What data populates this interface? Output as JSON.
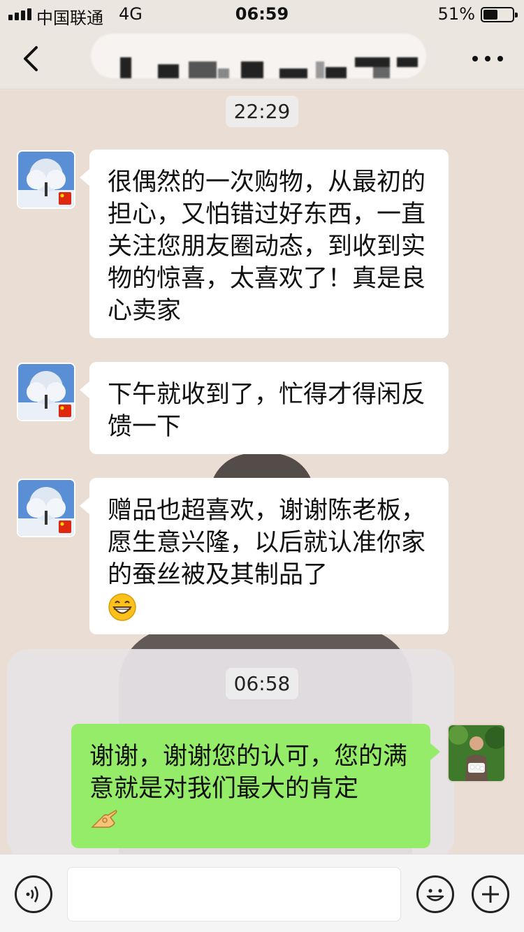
{
  "status_bar": {
    "carrier": "中国联通",
    "network": "4G",
    "time": "06:59",
    "battery_percent_label": "51%",
    "battery_level": 0.51
  },
  "nav": {
    "back_icon": "chevron-left-icon",
    "more_icon": "ellipsis-icon"
  },
  "messages": [
    {
      "type": "timestamp",
      "text": "22:29"
    },
    {
      "type": "incoming",
      "text": "很偶然的一次购物，从最初的担心，又怕错过好东西，一直关注您朋友圈动态，到收到实物的惊喜，太喜欢了！真是良心卖家"
    },
    {
      "type": "incoming",
      "text": "下午就收到了，忙得才得闲反馈一下"
    },
    {
      "type": "incoming",
      "text": "赠品也超喜欢，谢谢陈老板，愿生意兴隆，以后就认准你家的蚕丝被及其制品了",
      "emoji": "grinning-face-icon"
    },
    {
      "type": "timestamp",
      "text": "06:58"
    },
    {
      "type": "outgoing",
      "text": "谢谢，谢谢您的认可，您的满意就是对我们最大的肯定",
      "emoji": "ok-hand-icon"
    }
  ],
  "input_bar": {
    "voice_icon": "voice-icon",
    "emoji_icon": "smiley-icon",
    "plus_icon": "plus-icon",
    "input_value": ""
  },
  "colors": {
    "outgoing_bubble": "#95ec69",
    "incoming_bubble": "#ffffff",
    "chat_background": "#e9ddd4"
  }
}
